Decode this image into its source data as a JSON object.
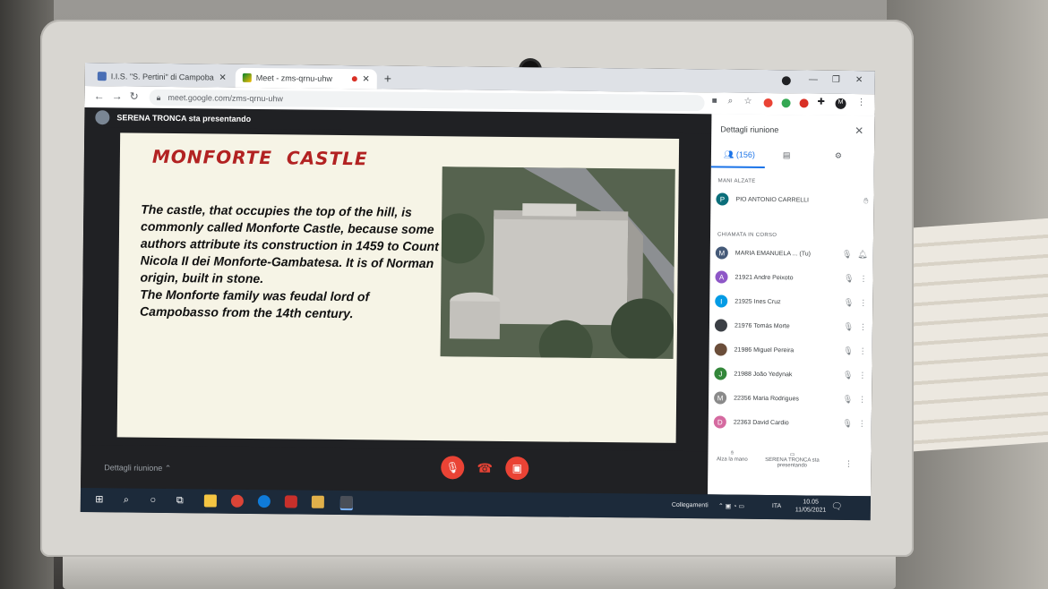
{
  "browser": {
    "tabs": [
      {
        "label": "I.I.S. \"S. Pertini\" di Campobasso",
        "active": false
      },
      {
        "label": "Meet - zms-qrnu-uhw",
        "active": true
      }
    ],
    "url": "meet.google.com/zms-qrnu-uhw",
    "avatar_letter": "M"
  },
  "meet": {
    "presenter_banner": "SERENA TRONCA sta presentando",
    "details_link": "Dettagli riunione",
    "slide": {
      "title": "MONFORTE   CASTLE",
      "paragraphs": [
        "The castle, that occupies the top of the hill, is commonly called Monforte Castle, because some authors attribute its construction in 1459 to Count Nicola II dei Monforte-Gambatesa. It is of Norman origin, built in stone.",
        "The Monforte family was feudal lord of Campobasso from the 14th century."
      ]
    }
  },
  "panel": {
    "title": "Dettagli riunione",
    "participant_count": "(156)",
    "raised_hands_label": "MANI ALZATE",
    "raised_hands": [
      {
        "initial": "P",
        "name": "PIO ANTONIO CARRELLI",
        "color": "#0b6e7a"
      }
    ],
    "in_call_label": "CHIAMATA IN CORSO",
    "participants": [
      {
        "initial": "M",
        "name": "MARIA EMANUELA ... (Tu)",
        "color": "#455a78"
      },
      {
        "initial": "A",
        "name": "21921 Andre Peixoto",
        "color": "#8e57c7"
      },
      {
        "initial": "I",
        "name": "21925 Ines Cruz",
        "color": "#039be5"
      },
      {
        "initial": "",
        "name": "21976 Tomás Morte",
        "color": "#3b3f45"
      },
      {
        "initial": "",
        "name": "21986 Miguel Pereira",
        "color": "#6b4e3a"
      },
      {
        "initial": "J",
        "name": "21988 João Yedynak",
        "color": "#33873a"
      },
      {
        "initial": "M",
        "name": "22356 Maria Rodrigues",
        "color": "#8a8a8a"
      },
      {
        "initial": "D",
        "name": "22363 David Cardio",
        "color": "#d56aa0"
      }
    ],
    "footer": {
      "raise_hand": "Alza la mano",
      "presenting": "SERENA TRONCA sta presentando"
    }
  },
  "taskbar": {
    "links_label": "Collegamenti",
    "lang": "ITA",
    "time": "10.05",
    "date": "11/05/2021"
  }
}
